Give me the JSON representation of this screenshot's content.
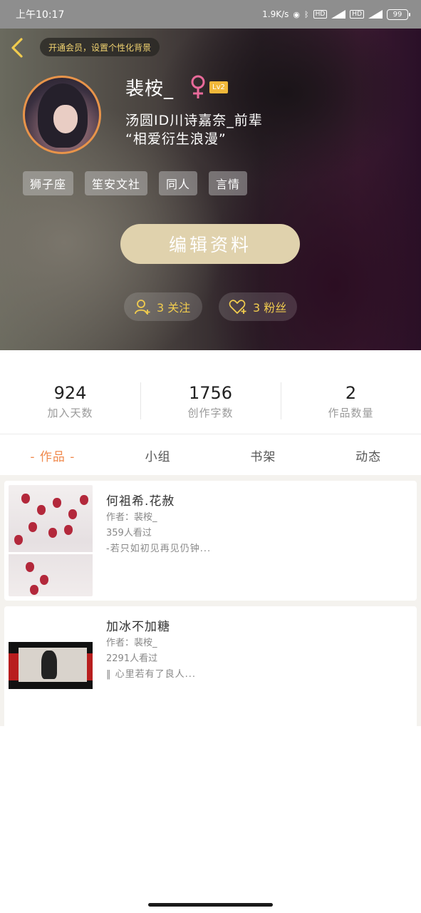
{
  "status_bar": {
    "time": "上午10:17",
    "net_speed": "1.9K/s",
    "battery": "99"
  },
  "header": {
    "vip_prompt": "开通会员，设置个性化背景",
    "username": "裴桉_",
    "level": "Lv2",
    "id_line": "汤圆ID川诗嘉奈_前辈",
    "motto": "“相爱衍生浪漫”",
    "tags": [
      "狮子座",
      "笙安文社",
      "同人",
      "言情"
    ],
    "edit_button": "编辑资料",
    "follow_label": "3 关注",
    "fans_label": "3 粉丝",
    "colors": {
      "accent_gold": "#f1cc4e",
      "edit_button_bg": "#e0d2ad",
      "avatar_ring": "#e8944a"
    }
  },
  "stats": [
    {
      "value": "924",
      "label": "加入天数"
    },
    {
      "value": "1756",
      "label": "创作字数"
    },
    {
      "value": "2",
      "label": "作品数量"
    }
  ],
  "tabs": [
    {
      "label": "- 作品 -",
      "active": true
    },
    {
      "label": "小组",
      "active": false
    },
    {
      "label": "书架",
      "active": false
    },
    {
      "label": "动态",
      "active": false
    }
  ],
  "works": [
    {
      "title": "何袓希.花赦",
      "author": "作者：裴桉_",
      "views": "359人看过",
      "excerpt": "-若只如初见再见仍钟..."
    },
    {
      "title": "加冰不加糖",
      "author": "作者：裴桉_",
      "views": "2291人看过",
      "excerpt": "‖ 心里若有了良人..."
    }
  ],
  "icons": [
    "back-arrow-icon",
    "female-icon",
    "add-user-icon",
    "heart-plus-icon"
  ]
}
